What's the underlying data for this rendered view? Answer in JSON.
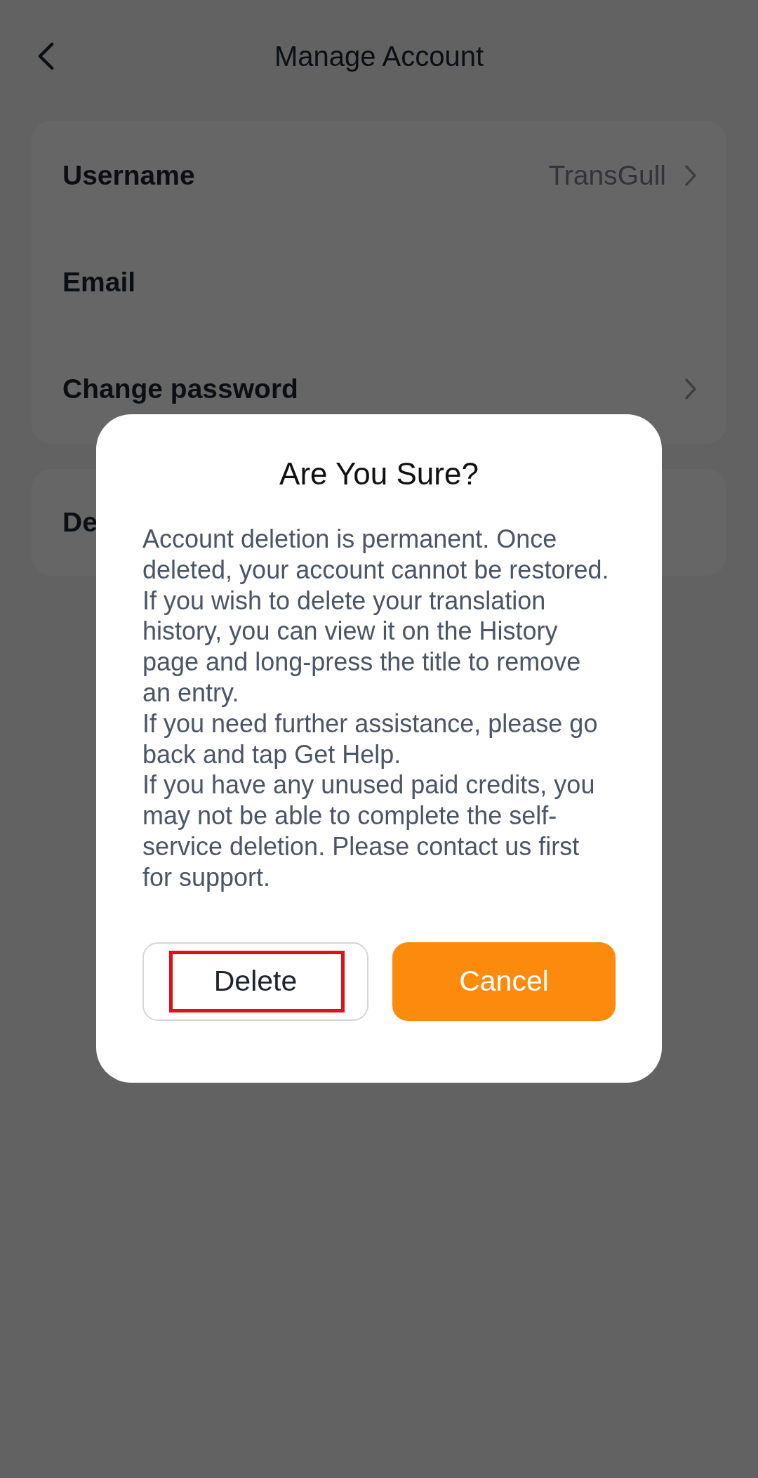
{
  "header": {
    "title": "Manage Account"
  },
  "account_rows": [
    {
      "label": "Username",
      "value": "TransGull",
      "chevron": true
    },
    {
      "label": "Email",
      "chevron": false
    },
    {
      "label": "Change password",
      "chevron": true
    }
  ],
  "danger_rows": [
    {
      "label": "De"
    }
  ],
  "dialog": {
    "title": "Are You Sure?",
    "paragraphs": [
      "Account deletion is permanent. Once deleted, your account cannot be restored.",
      "If you wish to delete your translation history, you can view it on the History page and long-press the title to remove an entry.",
      "If you need further assistance, please go back and tap Get Help.",
      "If you have any unused paid credits, you may not be able to complete the self-service deletion. Please contact us first for support."
    ],
    "buttons": [
      {
        "label": "Delete",
        "kind": "outline",
        "highlighted": true
      },
      {
        "label": "Cancel",
        "kind": "filled",
        "highlighted": false
      }
    ]
  }
}
